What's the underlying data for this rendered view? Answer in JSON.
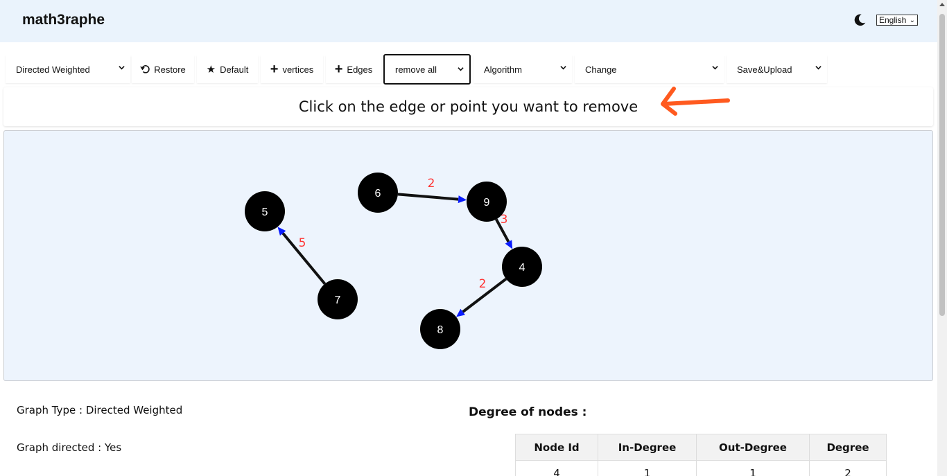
{
  "app": {
    "brand": "math3raphe"
  },
  "header": {
    "language": "English",
    "icons": {
      "theme_toggle": "moon-icon"
    }
  },
  "toolbar": {
    "graph_type": "Directed Weighted",
    "restore_label": "Restore",
    "default_label": "Default",
    "vertices_label": "vertices",
    "edges_label": "Edges",
    "remove_mode": "remove all",
    "algorithm": "Algorithm",
    "change": "Change",
    "save_upload": "Save&Upload"
  },
  "instruction": {
    "text": "Click on the edge or point you want to remove",
    "arrow_color": "#ff5a1f"
  },
  "graph": {
    "node_color": "#000000",
    "edge_color": "#111111",
    "arrow_head_color": "#0a1cff",
    "weight_color": "#ff3333",
    "nodes": [
      {
        "id": "5"
      },
      {
        "id": "6"
      },
      {
        "id": "9"
      },
      {
        "id": "4"
      },
      {
        "id": "7"
      },
      {
        "id": "8"
      }
    ],
    "edges": [
      {
        "from": "7",
        "to": "5",
        "weight": "5"
      },
      {
        "from": "6",
        "to": "9",
        "weight": "2"
      },
      {
        "from": "9",
        "to": "4",
        "weight": "3"
      },
      {
        "from": "4",
        "to": "8",
        "weight": "2"
      }
    ]
  },
  "info": {
    "graph_type_line": "Graph Type : Directed Weighted",
    "graph_directed_line": "Graph directed : Yes"
  },
  "degree": {
    "title": "Degree of nodes :",
    "headers": [
      "Node Id",
      "In-Degree",
      "Out-Degree",
      "Degree"
    ],
    "rows": [
      [
        "4",
        "1",
        "1",
        "2"
      ]
    ]
  }
}
